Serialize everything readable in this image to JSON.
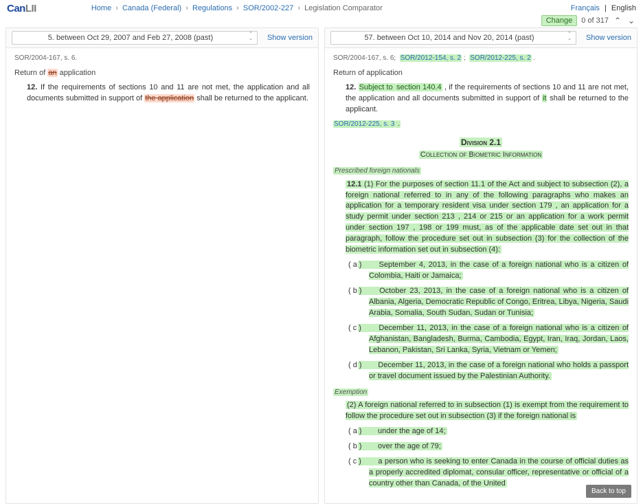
{
  "logo": {
    "part1": "Can",
    "part2": "LII"
  },
  "breadcrumbs": {
    "items": [
      "Home",
      "Canada (Federal)",
      "Regulations",
      "SOR/2002-227"
    ],
    "current": "Legislation Comparator",
    "sep": "›"
  },
  "lang": {
    "fr": "Français",
    "en": "English"
  },
  "change": {
    "label": "Change",
    "count": "0 of 317"
  },
  "left": {
    "version": "5. between Oct 29, 2007 and Feb 27, 2008 (past)",
    "show": "Show version",
    "sor_prefix": "SOR/2004-167, s. 6.",
    "heading_return": "Return of",
    "heading_an": "an",
    "heading_application": "application",
    "p12_num": "12.",
    "p12_a": " If the requirements of sections 10 and 11 are not met, the application and all documents submitted in support of ",
    "p12_del": "the application",
    "p12_b": " shall be returned to the applicant."
  },
  "right": {
    "version": "57. between Oct 10, 2014 and Nov 20, 2014 (past)",
    "show": "Show version",
    "sor_prefix": "SOR/2004-167, s. 6;",
    "sor_link1": "SOR/2012-154, s. 2",
    "sor_sep": ";",
    "sor_link2": "SOR/2012-225, s. 2",
    "sor_dot": ".",
    "heading": "Return of application",
    "p12_num": "12.",
    "p12_add1": "Subject to ",
    "p12_add_sec": "section 140.4",
    "p12_add_comma": " , ",
    "p12_a": "if the requirements of sections 10 and 11 are not met, the application and all documents submitted in support of ",
    "p12_it": "it",
    "p12_b": " shall be returned to the applicant.",
    "foot12": "SOR/2012-225, s. 3",
    "foot12_dot": " .",
    "division_num": "Division 2.1",
    "division_title": "Collection of Biometric Information",
    "sub_prescribed": "Prescribed foreign nationals",
    "p12_1_num": "12.1",
    "p12_1_sub": "(1)",
    "p12_1_a": " For the purposes of section 11.1 of the Act and subject to subsection (2), a foreign national referred to in any of the following paragraphs who makes an application for a temporary resident visa under ",
    "p12_1_s179": "section 179",
    "p12_1_b": " , an application for a study permit under ",
    "p12_1_s213": "section 213",
    "p12_1_comma1": " , ",
    "p12_1_s214": "214",
    "p12_1_or1": " or ",
    "p12_1_s215": "215",
    "p12_1_c": " or an application for a work permit under ",
    "p12_1_s197": "section 197",
    "p12_1_comma2": " , ",
    "p12_1_s198": "198",
    "p12_1_or2": " or ",
    "p12_1_s199": "199",
    "p12_1_d": " must, as of the applicable date set out in that paragraph, follow the procedure set out in subsection (3) for the collection of the biometric information set out in subsection (4):",
    "li_a_lbl": "( a )",
    "li_a": " September 4, 2013, in the case of a foreign national who is a citizen of Colombia, Haiti or Jamaica;",
    "li_b_lbl": "( b )",
    "li_b": " October 23, 2013, in the case of a foreign national who is a citizen of Albania, Algeria, Democratic Republic of Congo, Eritrea, Libya, Nigeria, Saudi Arabia, Somalia, South Sudan, Sudan or Tunisia;",
    "li_c_lbl": "( c )",
    "li_c": " December 11, 2013, in the case of a foreign national who is a citizen of Afghanistan, Bangladesh, Burma, Cambodia, Egypt, Iran, Iraq, Jordan, Laos, Lebanon, Pakistan, Sri Lanka, Syria, Vietnam or Yemen;",
    "li_d_lbl": "( d )",
    "li_d": " December 11, 2013, in the case of a foreign national who holds a passport or travel document issued by the Palestinian Authority.",
    "sub_exemption": "Exemption",
    "p2_num": "(2)",
    "p2": " A foreign national referred to in subsection (1) is exempt from the requirement to follow the procedure set out in subsection (3) if the foreign national is",
    "li2_a_lbl": "( a )",
    "li2_a": " under the age of 14;",
    "li2_b_lbl": "( b )",
    "li2_b": " over the age of 79;",
    "li2_c_lbl": "( c )",
    "li2_c": " a person who is seeking to enter Canada in the course of official duties as a properly accredited diplomat, consular officer, representative or official of a country other than Canada, of the United"
  },
  "backtotop": "Back to top"
}
